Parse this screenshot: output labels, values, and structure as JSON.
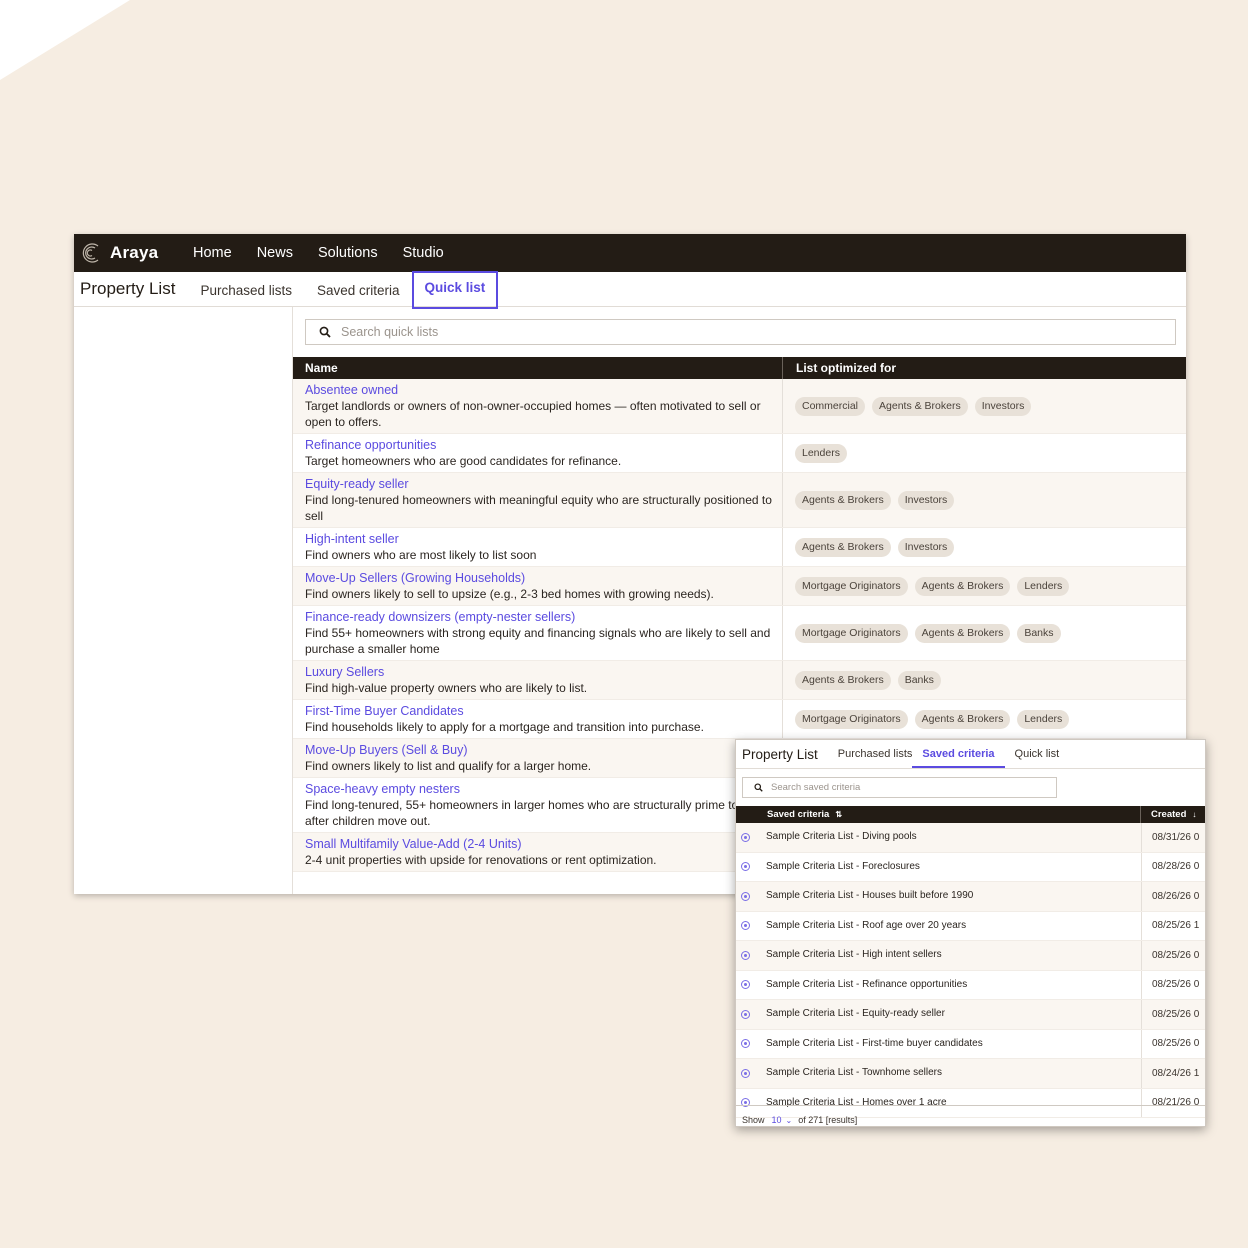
{
  "app": {
    "brand": "Araya",
    "nav": [
      "Home",
      "News",
      "Solutions",
      "Studio"
    ]
  },
  "main": {
    "title": "Property List",
    "tabs": [
      {
        "label": "Purchased lists"
      },
      {
        "label": "Saved criteria"
      },
      {
        "label": "Quick list",
        "active": true
      }
    ],
    "search": {
      "placeholder": "Search quick lists",
      "value": ""
    },
    "table": {
      "columns": [
        "Name",
        "List optimized for"
      ],
      "rows": [
        {
          "title": "Absentee owned",
          "desc": "Target landlords or owners of non-owner-occupied homes — often motivated to sell or open to offers.",
          "tags": [
            "Commercial",
            "Agents & Brokers",
            "Investors"
          ]
        },
        {
          "title": "Refinance opportunities",
          "desc": "Target homeowners who are good candidates for refinance.",
          "tags": [
            "Lenders"
          ]
        },
        {
          "title": "Equity-ready seller",
          "desc": "Find long-tenured homeowners with meaningful equity who are structurally positioned to sell",
          "tags": [
            "Agents & Brokers",
            "Investors"
          ]
        },
        {
          "title": "High-intent seller",
          "desc": "Find owners who are most likely to list soon",
          "tags": [
            "Agents & Brokers",
            "Investors"
          ]
        },
        {
          "title": "Move-Up Sellers (Growing Households)",
          "desc": "Find owners likely to sell to upsize (e.g., 2-3 bed homes with growing needs).",
          "tags": [
            "Mortgage Originators",
            "Agents & Brokers",
            "Lenders"
          ]
        },
        {
          "title": "Finance-ready downsizers (empty-nester sellers)",
          "desc": "Find 55+ homeowners with strong equity and financing signals who are likely to sell and purchase a smaller home",
          "tags": [
            "Mortgage Originators",
            "Agents & Brokers",
            "Banks"
          ]
        },
        {
          "title": "Luxury Sellers",
          "desc": "Find high-value property owners who are likely to list.",
          "tags": [
            "Agents & Brokers",
            "Banks"
          ]
        },
        {
          "title": "First-Time Buyer Candidates",
          "desc": "Find households likely to apply for a mortgage and transition into purchase.",
          "tags": [
            "Mortgage Originators",
            "Agents & Brokers",
            "Lenders"
          ]
        },
        {
          "title": "Move-Up Buyers (Sell & Buy)",
          "desc": "Find owners likely to list and qualify for a larger home.",
          "tags": []
        },
        {
          "title": "Space-heavy empty nesters",
          "desc": "Find long-tenured, 55+ homeowners in larger homes who are structurally prime to sell after children move out.",
          "tags": []
        },
        {
          "title": "Small Multifamily Value-Add (2-4 Units)",
          "desc": "2-4 unit properties with upside for renovations or rent optimization.",
          "tags": []
        }
      ]
    }
  },
  "overlay": {
    "title": "Property List",
    "tabs": [
      {
        "label": "Purchased lists"
      },
      {
        "label": "Saved criteria",
        "active": true
      },
      {
        "label": "Quick list"
      }
    ],
    "search": {
      "placeholder": "Search saved criteria",
      "value": ""
    },
    "columns": [
      "Saved criteria",
      "Created"
    ],
    "rows": [
      {
        "name": "Sample Criteria List - Diving pools",
        "created": "08/31/26 0"
      },
      {
        "name": "Sample Criteria List - Foreclosures",
        "created": "08/28/26 0"
      },
      {
        "name": "Sample Criteria List - Houses built before 1990",
        "created": "08/26/26 0"
      },
      {
        "name": "Sample Criteria List - Roof age over 20 years",
        "created": "08/25/26 1"
      },
      {
        "name": "Sample Criteria List - High intent sellers",
        "created": "08/25/26 0"
      },
      {
        "name": "Sample Criteria List - Refinance opportunities",
        "created": "08/25/26 0"
      },
      {
        "name": "Sample Criteria List - Equity-ready seller",
        "created": "08/25/26 0"
      },
      {
        "name": "Sample Criteria List - First-time buyer candidates",
        "created": "08/25/26 0"
      },
      {
        "name": "Sample Criteria List - Townhome sellers",
        "created": "08/24/26 1"
      },
      {
        "name": "Sample Criteria List - Homes over 1 acre",
        "created": "08/21/26 0"
      }
    ],
    "footer": {
      "show_label": "Show",
      "show_value": "10",
      "of_text": "of 271 [results]"
    }
  },
  "colors": {
    "accent": "#5b4be0",
    "nav_bg": "#231c15",
    "page_bg": "#f6ede2",
    "tag_bg": "#e8e1d8"
  },
  "icons": {
    "logo": "araya-logo-icon",
    "search": "search-icon",
    "sort": "sort-icon",
    "radio": "radio-icon"
  }
}
